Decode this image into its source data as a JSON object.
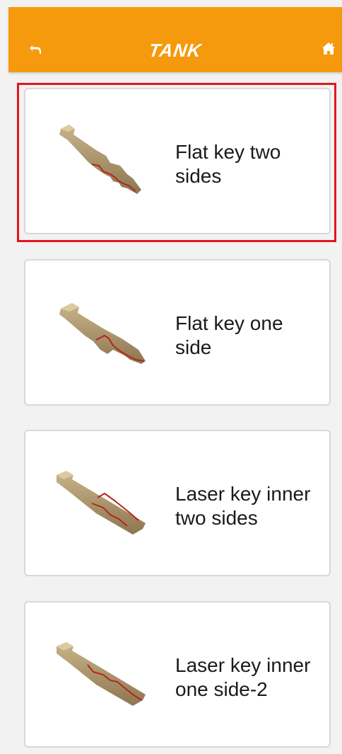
{
  "header": {
    "title": "TANK",
    "back_icon": "back-arrow-icon",
    "home_icon": "home-icon",
    "background_color": "#f59a0c"
  },
  "selection_color": "#e3151b",
  "key_types": [
    {
      "label": "Flat key two\nsides",
      "icon": "flat-key-two-sides-icon",
      "selected": true
    },
    {
      "label": "Flat key one\nside",
      "icon": "flat-key-one-side-icon",
      "selected": false
    },
    {
      "label": "Laser key inner\ntwo sides",
      "icon": "laser-key-inner-two-sides-icon",
      "selected": false
    },
    {
      "label": "Laser key inner\none side-2",
      "icon": "laser-key-inner-one-side-2-icon",
      "selected": false
    }
  ]
}
